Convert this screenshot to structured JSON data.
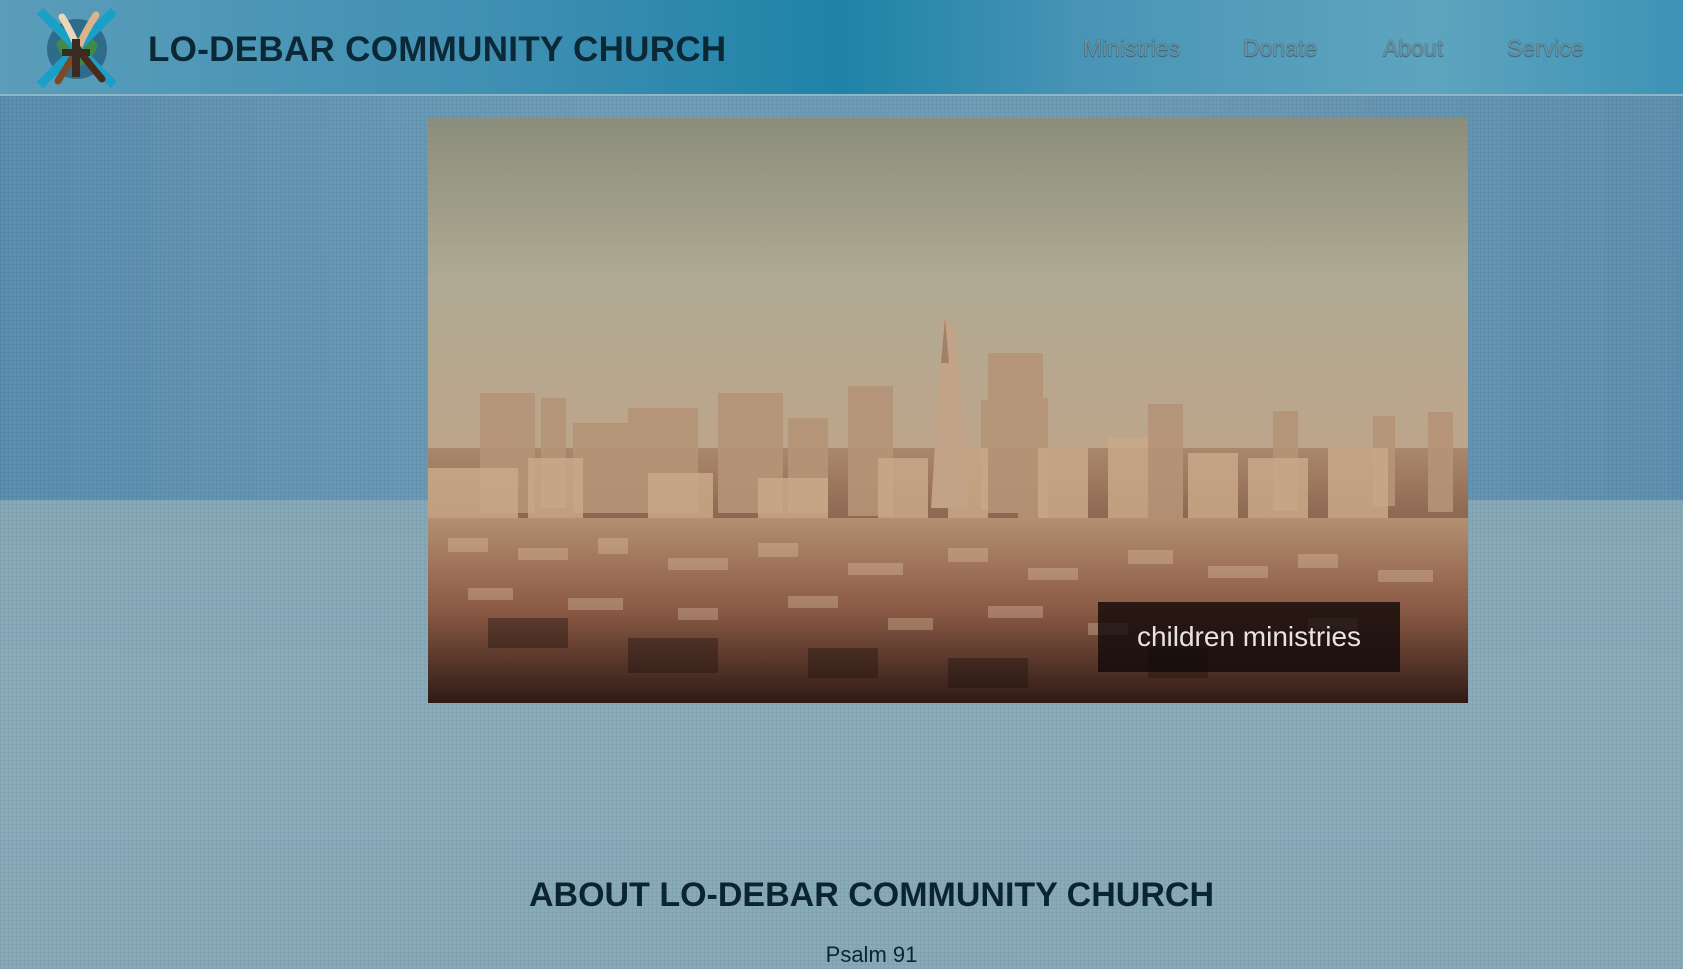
{
  "header": {
    "title": "LO-DEBAR COMMUNITY CHURCH",
    "logo_icon": "hands-globe-cross-logo",
    "nav": [
      {
        "label": "Ministries"
      },
      {
        "label": "Donate"
      },
      {
        "label": "About"
      },
      {
        "label": "Service"
      }
    ]
  },
  "hero": {
    "image_icon": "city-skyline-image",
    "caption": "children ministries"
  },
  "about": {
    "heading": "ABOUT LO-DEBAR COMMUNITY CHURCH",
    "subtext": "Psalm 91"
  },
  "colors": {
    "header_accent": "#1f83a8",
    "background": "#7fa3b1",
    "title_text": "#0b2836",
    "nav_text": "#6b8f9f"
  }
}
